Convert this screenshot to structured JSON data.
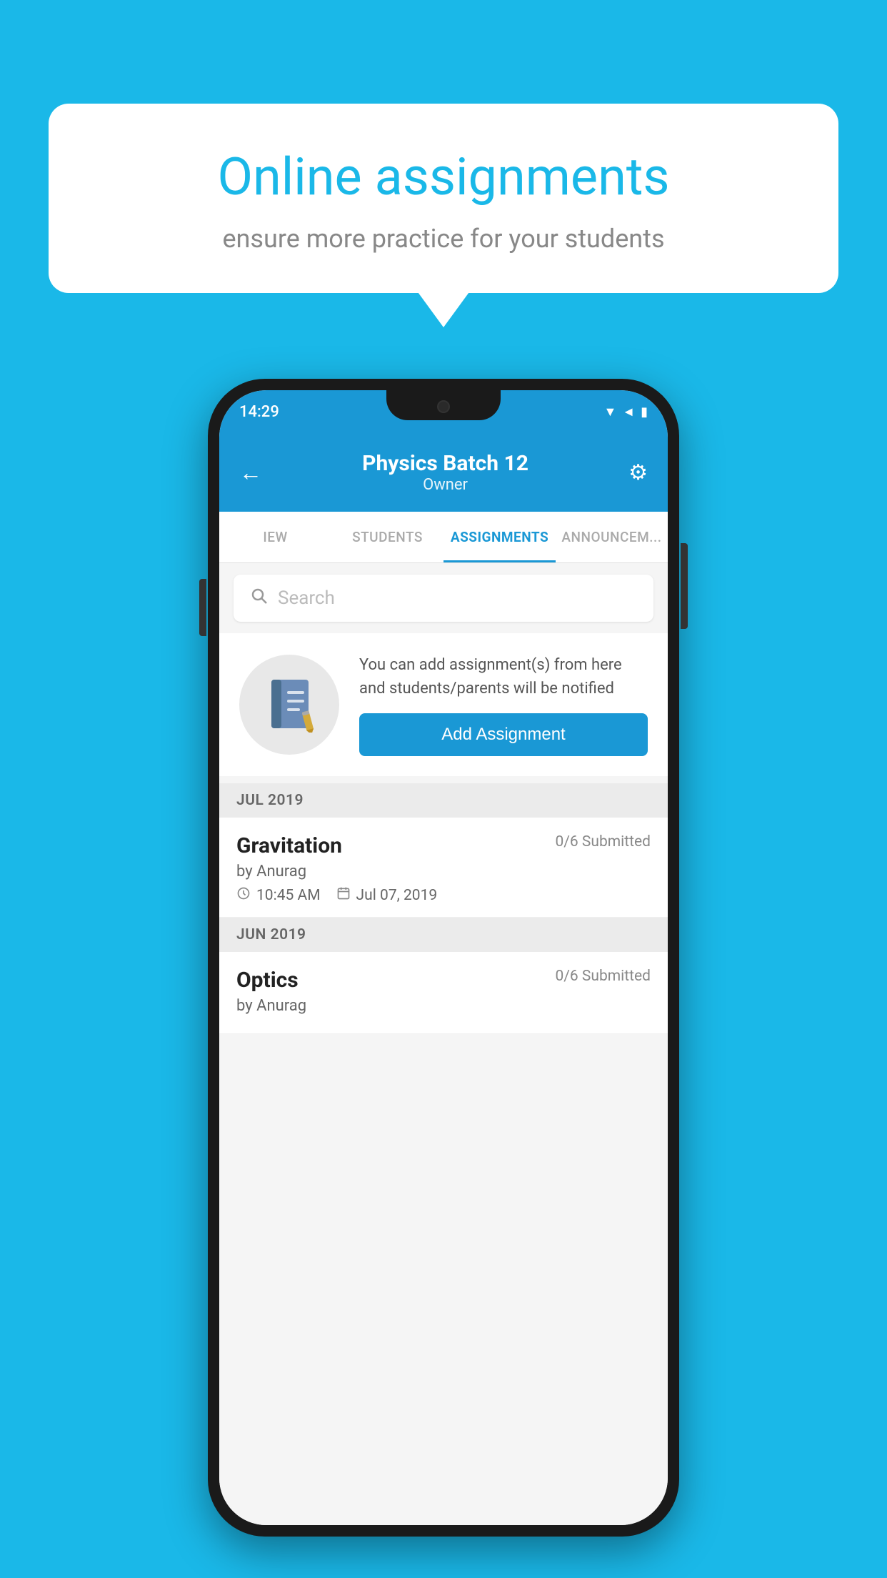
{
  "background": {
    "color": "#1ab8e8"
  },
  "speech_bubble": {
    "title": "Online assignments",
    "subtitle": "ensure more practice for your students"
  },
  "phone": {
    "status_bar": {
      "time": "14:29",
      "icons": [
        "wifi",
        "signal",
        "battery"
      ]
    },
    "app_bar": {
      "title": "Physics Batch 12",
      "subtitle": "Owner",
      "back_label": "←",
      "settings_label": "⚙"
    },
    "tabs": [
      {
        "label": "IEW",
        "active": false
      },
      {
        "label": "STUDENTS",
        "active": false
      },
      {
        "label": "ASSIGNMENTS",
        "active": true
      },
      {
        "label": "ANNOUNCEM...",
        "active": false
      }
    ],
    "search": {
      "placeholder": "Search"
    },
    "add_assignment_card": {
      "description": "You can add assignment(s) from here and students/parents will be notified",
      "button_label": "Add Assignment"
    },
    "sections": [
      {
        "header": "JUL 2019",
        "assignments": [
          {
            "name": "Gravitation",
            "submitted": "0/6 Submitted",
            "by": "by Anurag",
            "time": "10:45 AM",
            "date": "Jul 07, 2019"
          }
        ]
      },
      {
        "header": "JUN 2019",
        "assignments": [
          {
            "name": "Optics",
            "submitted": "0/6 Submitted",
            "by": "by Anurag",
            "time": "",
            "date": ""
          }
        ]
      }
    ]
  }
}
